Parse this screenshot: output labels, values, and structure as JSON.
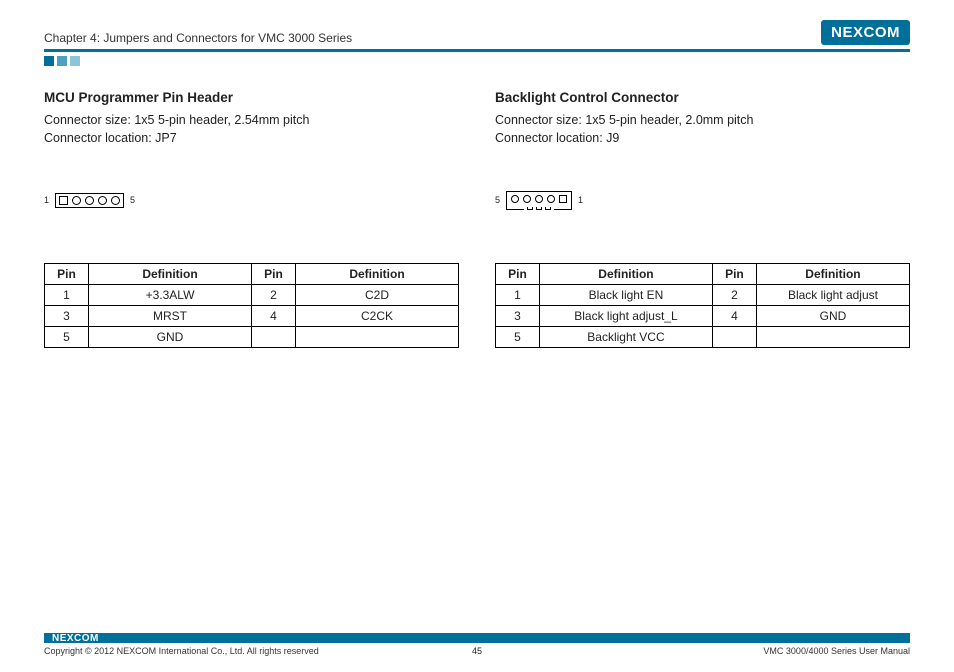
{
  "header": {
    "chapter": "Chapter 4: Jumpers and Connectors for VMC 3000 Series",
    "brand": "NEXCOM"
  },
  "left": {
    "title": "MCU Programmer Pin Header",
    "size": "Connector size: 1x5 5-pin header, 2.54mm pitch",
    "loc": "Connector location: JP7",
    "label_left": "1",
    "label_right": "5",
    "th_pin": "Pin",
    "th_def": "Definition",
    "rows": [
      {
        "p1": "1",
        "d1": "+3.3ALW",
        "p2": "2",
        "d2": "C2D"
      },
      {
        "p1": "3",
        "d1": "MRST",
        "p2": "4",
        "d2": "C2CK"
      },
      {
        "p1": "5",
        "d1": "GND",
        "p2": "",
        "d2": ""
      }
    ]
  },
  "right": {
    "title": "Backlight Control Connector",
    "size": "Connector size: 1x5 5-pin header, 2.0mm pitch",
    "loc": "Connector location: J9",
    "label_left": "5",
    "label_right": "1",
    "th_pin": "Pin",
    "th_def": "Definition",
    "rows": [
      {
        "p1": "1",
        "d1": "Black light EN",
        "p2": "2",
        "d2": "Black light adjust"
      },
      {
        "p1": "3",
        "d1": "Black light adjust_L",
        "p2": "4",
        "d2": "GND"
      },
      {
        "p1": "5",
        "d1": "Backlight VCC",
        "p2": "",
        "d2": ""
      }
    ]
  },
  "footer": {
    "brand": "NEXCOM",
    "copyright": "Copyright © 2012 NEXCOM International Co., Ltd. All rights reserved",
    "page": "45",
    "doc": "VMC 3000/4000 Series User Manual"
  }
}
